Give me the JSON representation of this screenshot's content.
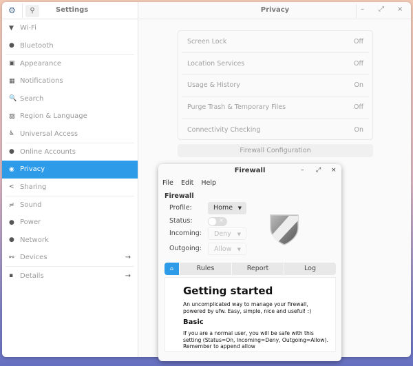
{
  "settings": {
    "sidebar_title": "Settings",
    "items": [
      {
        "label": "Wi-Fi",
        "icon": "wifi-icon",
        "glyph": "▼"
      },
      {
        "label": "Bluetooth",
        "icon": "bluetooth-icon",
        "glyph": "●"
      },
      {
        "label": "Appearance",
        "icon": "monitor-icon",
        "glyph": "▣"
      },
      {
        "label": "Notifications",
        "icon": "notifications-icon",
        "glyph": "▦"
      },
      {
        "label": "Search",
        "icon": "search-icon",
        "glyph": "🔍"
      },
      {
        "label": "Region & Language",
        "icon": "region-icon",
        "glyph": "▨"
      },
      {
        "label": "Universal Access",
        "icon": "accessibility-icon",
        "glyph": "♿"
      },
      {
        "label": "Online Accounts",
        "icon": "online-accounts-icon",
        "glyph": "●"
      },
      {
        "label": "Privacy",
        "icon": "privacy-icon",
        "glyph": "◉",
        "selected": true
      },
      {
        "label": "Sharing",
        "icon": "share-icon",
        "glyph": "<"
      },
      {
        "label": "Sound",
        "icon": "sound-icon",
        "glyph": "≓"
      },
      {
        "label": "Power",
        "icon": "power-icon",
        "glyph": "●"
      },
      {
        "label": "Network",
        "icon": "network-icon",
        "glyph": "●"
      },
      {
        "label": "Devices",
        "icon": "devices-icon",
        "glyph": "⚯",
        "arrow": "→"
      },
      {
        "label": "Details",
        "icon": "details-icon",
        "glyph": "▪",
        "arrow": "→"
      }
    ],
    "page_title": "Privacy",
    "window_controls": {
      "minimize": "–",
      "maximize": "⤢",
      "close": "×"
    },
    "rows": [
      {
        "label": "Screen Lock",
        "value": "Off"
      },
      {
        "label": "Location Services",
        "value": "Off"
      },
      {
        "label": "Usage & History",
        "value": "On"
      },
      {
        "label": "Purge Trash & Temporary Files",
        "value": "Off"
      },
      {
        "label": "Connectivity Checking",
        "value": "On"
      }
    ],
    "firewall_button": "Firewall Configuration",
    "accent": "#2d9be8"
  },
  "firewall": {
    "title": "Firewall",
    "menu": [
      "File",
      "Edit",
      "Help"
    ],
    "section": "Firewall",
    "profile_label": "Profile:",
    "profile_value": "Home",
    "status_label": "Status:",
    "status_on": false,
    "incoming_label": "Incoming:",
    "incoming_value": "Deny",
    "outgoing_label": "Outgoing:",
    "outgoing_value": "Allow",
    "tabs": [
      "Rules",
      "Report",
      "Log"
    ],
    "content": {
      "heading": "Getting started",
      "intro": "An uncomplicated way to manage your firewall, powered by ufw. Easy, simple, nice and useful! :)",
      "subheading": "Basic",
      "basic": "If you are a normal user, you will be safe with this setting (Status=On, Incoming=Deny, Outgoing=Allow). Remember to append allow"
    }
  }
}
